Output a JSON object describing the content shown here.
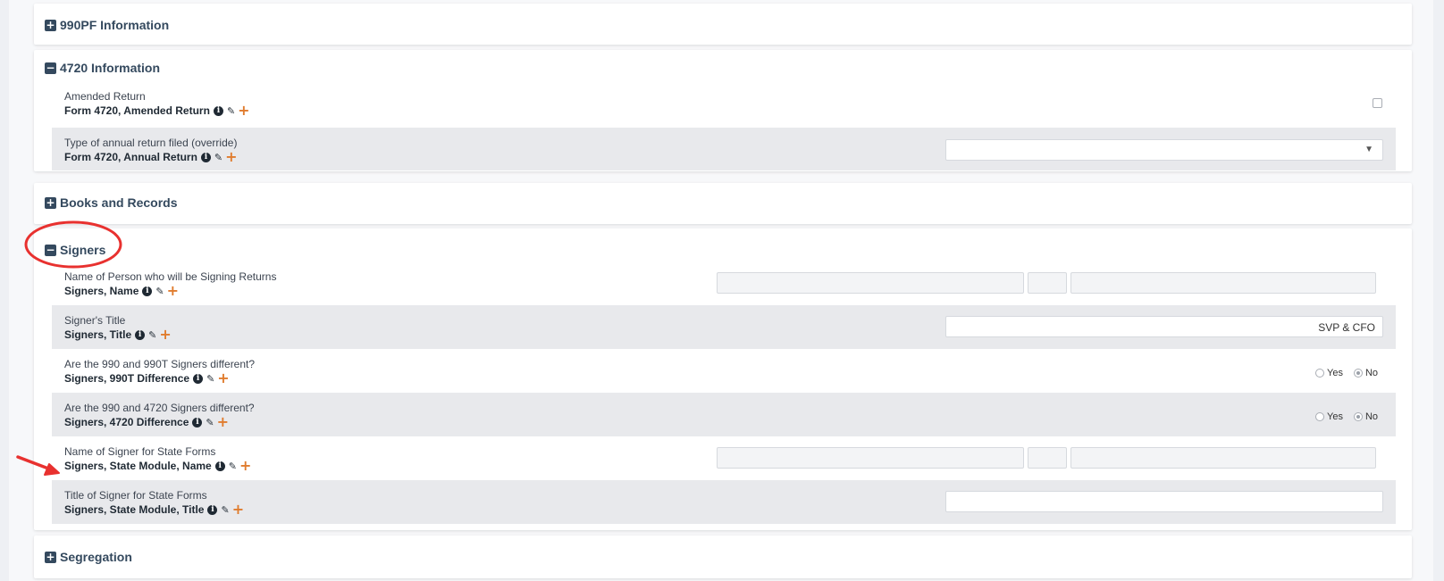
{
  "sections": {
    "s990pf": {
      "label": "990PF Information",
      "toggle": "+"
    },
    "s4720": {
      "label": "4720 Information",
      "toggle": "−"
    },
    "books": {
      "label": "Books and Records",
      "toggle": "+"
    },
    "signers": {
      "label": "Signers",
      "toggle": "−"
    },
    "segregation": {
      "label": "Segregation",
      "toggle": "+"
    }
  },
  "rows": {
    "amended": {
      "label": "Amended Return",
      "sub": "Form 4720, Amended Return"
    },
    "annual": {
      "label": "Type of annual return filed (override)",
      "sub": "Form 4720, Annual Return",
      "value": ""
    },
    "signer_name": {
      "label": "Name of Person who will be Signing Returns",
      "sub": "Signers, Name"
    },
    "signer_title": {
      "label": "Signer's Title",
      "sub": "Signers, Title",
      "value": "SVP & CFO"
    },
    "diff_990t": {
      "label": "Are the 990 and 990T Signers different?",
      "sub": "Signers, 990T Difference",
      "yes": "Yes",
      "no": "No"
    },
    "diff_4720": {
      "label": "Are the 990 and 4720 Signers different?",
      "sub": "Signers, 4720 Difference",
      "yes": "Yes",
      "no": "No"
    },
    "state_name": {
      "label": "Name of Signer for State Forms",
      "sub": "Signers, State Module, Name"
    },
    "state_title": {
      "label": "Title of Signer for State Forms",
      "sub": "Signers, State Module, Title",
      "value": ""
    }
  },
  "icons": {
    "info": "i",
    "pencil": "✎",
    "plus": "+",
    "caret": "▼"
  },
  "colors": {
    "accent_plus": "#e07c2e",
    "annotation_red": "#e8312f",
    "header_text": "#34495e"
  }
}
